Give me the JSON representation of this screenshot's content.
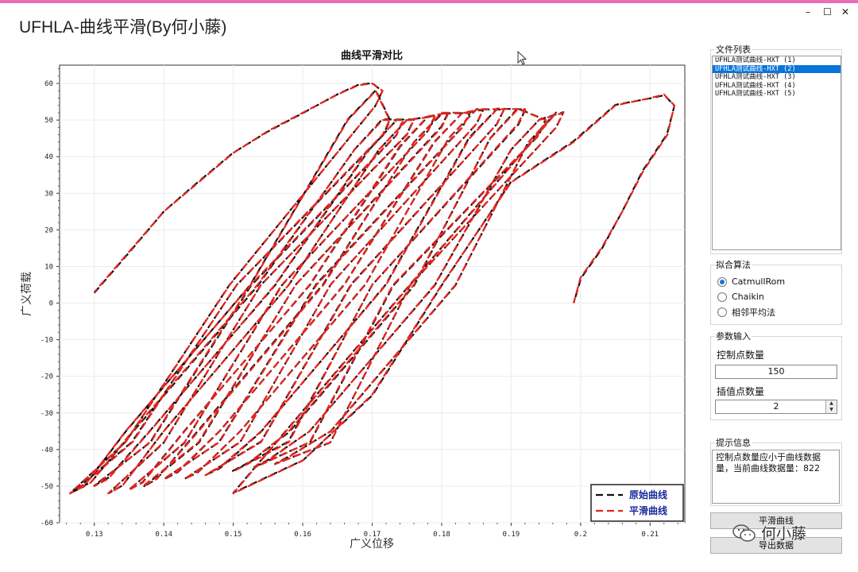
{
  "window": {
    "title": "UFHLA-曲线平滑(By何小藤)",
    "minimize": "–",
    "maximize": "☐",
    "close": "✕"
  },
  "chart_data": {
    "type": "line",
    "title": "曲线平滑对比",
    "xlabel": "广义位移",
    "ylabel": "广义荷载",
    "xlim": [
      0.125,
      0.215
    ],
    "ylim": [
      -60,
      65
    ],
    "x_ticks": [
      "0.13",
      "0.14",
      "0.15",
      "0.16",
      "0.17",
      "0.18",
      "0.19",
      "0.2",
      "0.21"
    ],
    "y_ticks": [
      "60",
      "50",
      "40",
      "30",
      "20",
      "10",
      "0",
      "-10",
      "-20",
      "-30",
      "-40",
      "-50",
      "-60"
    ],
    "grid": true,
    "legend_position": "bottom-right",
    "colors": {
      "original": "#111111",
      "smoothed": "#e8231f"
    },
    "series": [
      {
        "name": "原始曲线",
        "style": "dashed-black"
      },
      {
        "name": "平滑曲线",
        "style": "dashed-red"
      }
    ],
    "envelope": [
      [
        0.13,
        3
      ],
      [
        0.135,
        14
      ],
      [
        0.14,
        25
      ],
      [
        0.145,
        33
      ],
      [
        0.15,
        41
      ],
      [
        0.155,
        47
      ],
      [
        0.16,
        52
      ],
      [
        0.165,
        57
      ],
      [
        0.168,
        59.5
      ],
      [
        0.17,
        60
      ]
    ],
    "loops": [
      {
        "x0": 0.1265,
        "x1": 0.1715,
        "ymin": -52,
        "ymax": 58
      },
      {
        "x0": 0.1275,
        "x1": 0.1725,
        "ymin": -51,
        "ymax": 50
      },
      {
        "x0": 0.13,
        "x1": 0.1745,
        "ymin": -50,
        "ymax": 50
      },
      {
        "x0": 0.132,
        "x1": 0.176,
        "ymin": -52,
        "ymax": 50
      },
      {
        "x0": 0.135,
        "x1": 0.179,
        "ymin": -51,
        "ymax": 51
      },
      {
        "x0": 0.137,
        "x1": 0.181,
        "ymin": -50,
        "ymax": 52
      },
      {
        "x0": 0.14,
        "x1": 0.184,
        "ymin": -48,
        "ymax": 52
      },
      {
        "x0": 0.143,
        "x1": 0.186,
        "ymin": -48,
        "ymax": 53
      },
      {
        "x0": 0.146,
        "x1": 0.189,
        "ymin": -47,
        "ymax": 53
      },
      {
        "x0": 0.15,
        "x1": 0.192,
        "ymin": -46,
        "ymax": 53
      },
      {
        "x0": 0.153,
        "x1": 0.195,
        "ymin": -45,
        "ymax": 50
      },
      {
        "x0": 0.156,
        "x1": 0.1975,
        "ymin": -44,
        "ymax": 52
      }
    ],
    "unload_tail": [
      [
        0.15,
        -52
      ],
      [
        0.16,
        -43
      ],
      [
        0.17,
        -25
      ],
      [
        0.18,
        5
      ],
      [
        0.19,
        33
      ],
      [
        0.199,
        44
      ],
      [
        0.205,
        54
      ],
      [
        0.21,
        56
      ],
      [
        0.212,
        57
      ],
      [
        0.2135,
        54
      ],
      [
        0.2125,
        46
      ],
      [
        0.209,
        36
      ],
      [
        0.206,
        25
      ],
      [
        0.203,
        15
      ],
      [
        0.2,
        7
      ],
      [
        0.199,
        0
      ]
    ]
  },
  "file_list": {
    "label": "文件列表",
    "items": [
      "UFHLA测试曲线-HXT (1)",
      "UFHLA测试曲线-HXT (2)",
      "UFHLA测试曲线-HXT (3)",
      "UFHLA测试曲线-HXT (4)",
      "UFHLA测试曲线-HXT (5)"
    ],
    "selected_index": 1
  },
  "algo": {
    "label": "拟合算法",
    "options": [
      "CatmullRom",
      "Chaikin",
      "相邻平均法"
    ],
    "selected_index": 0
  },
  "params": {
    "label": "参数输入",
    "ctrl_label": "控制点数量",
    "ctrl_value": "150",
    "interp_label": "插值点数量",
    "interp_value": "2"
  },
  "hint": {
    "label": "提示信息",
    "text": "控制点数量应小于曲线数据量，当前曲线数据量：822"
  },
  "buttons": {
    "smooth": "平滑曲线",
    "export": "导出数据"
  },
  "watermark": {
    "text": "何小藤"
  }
}
